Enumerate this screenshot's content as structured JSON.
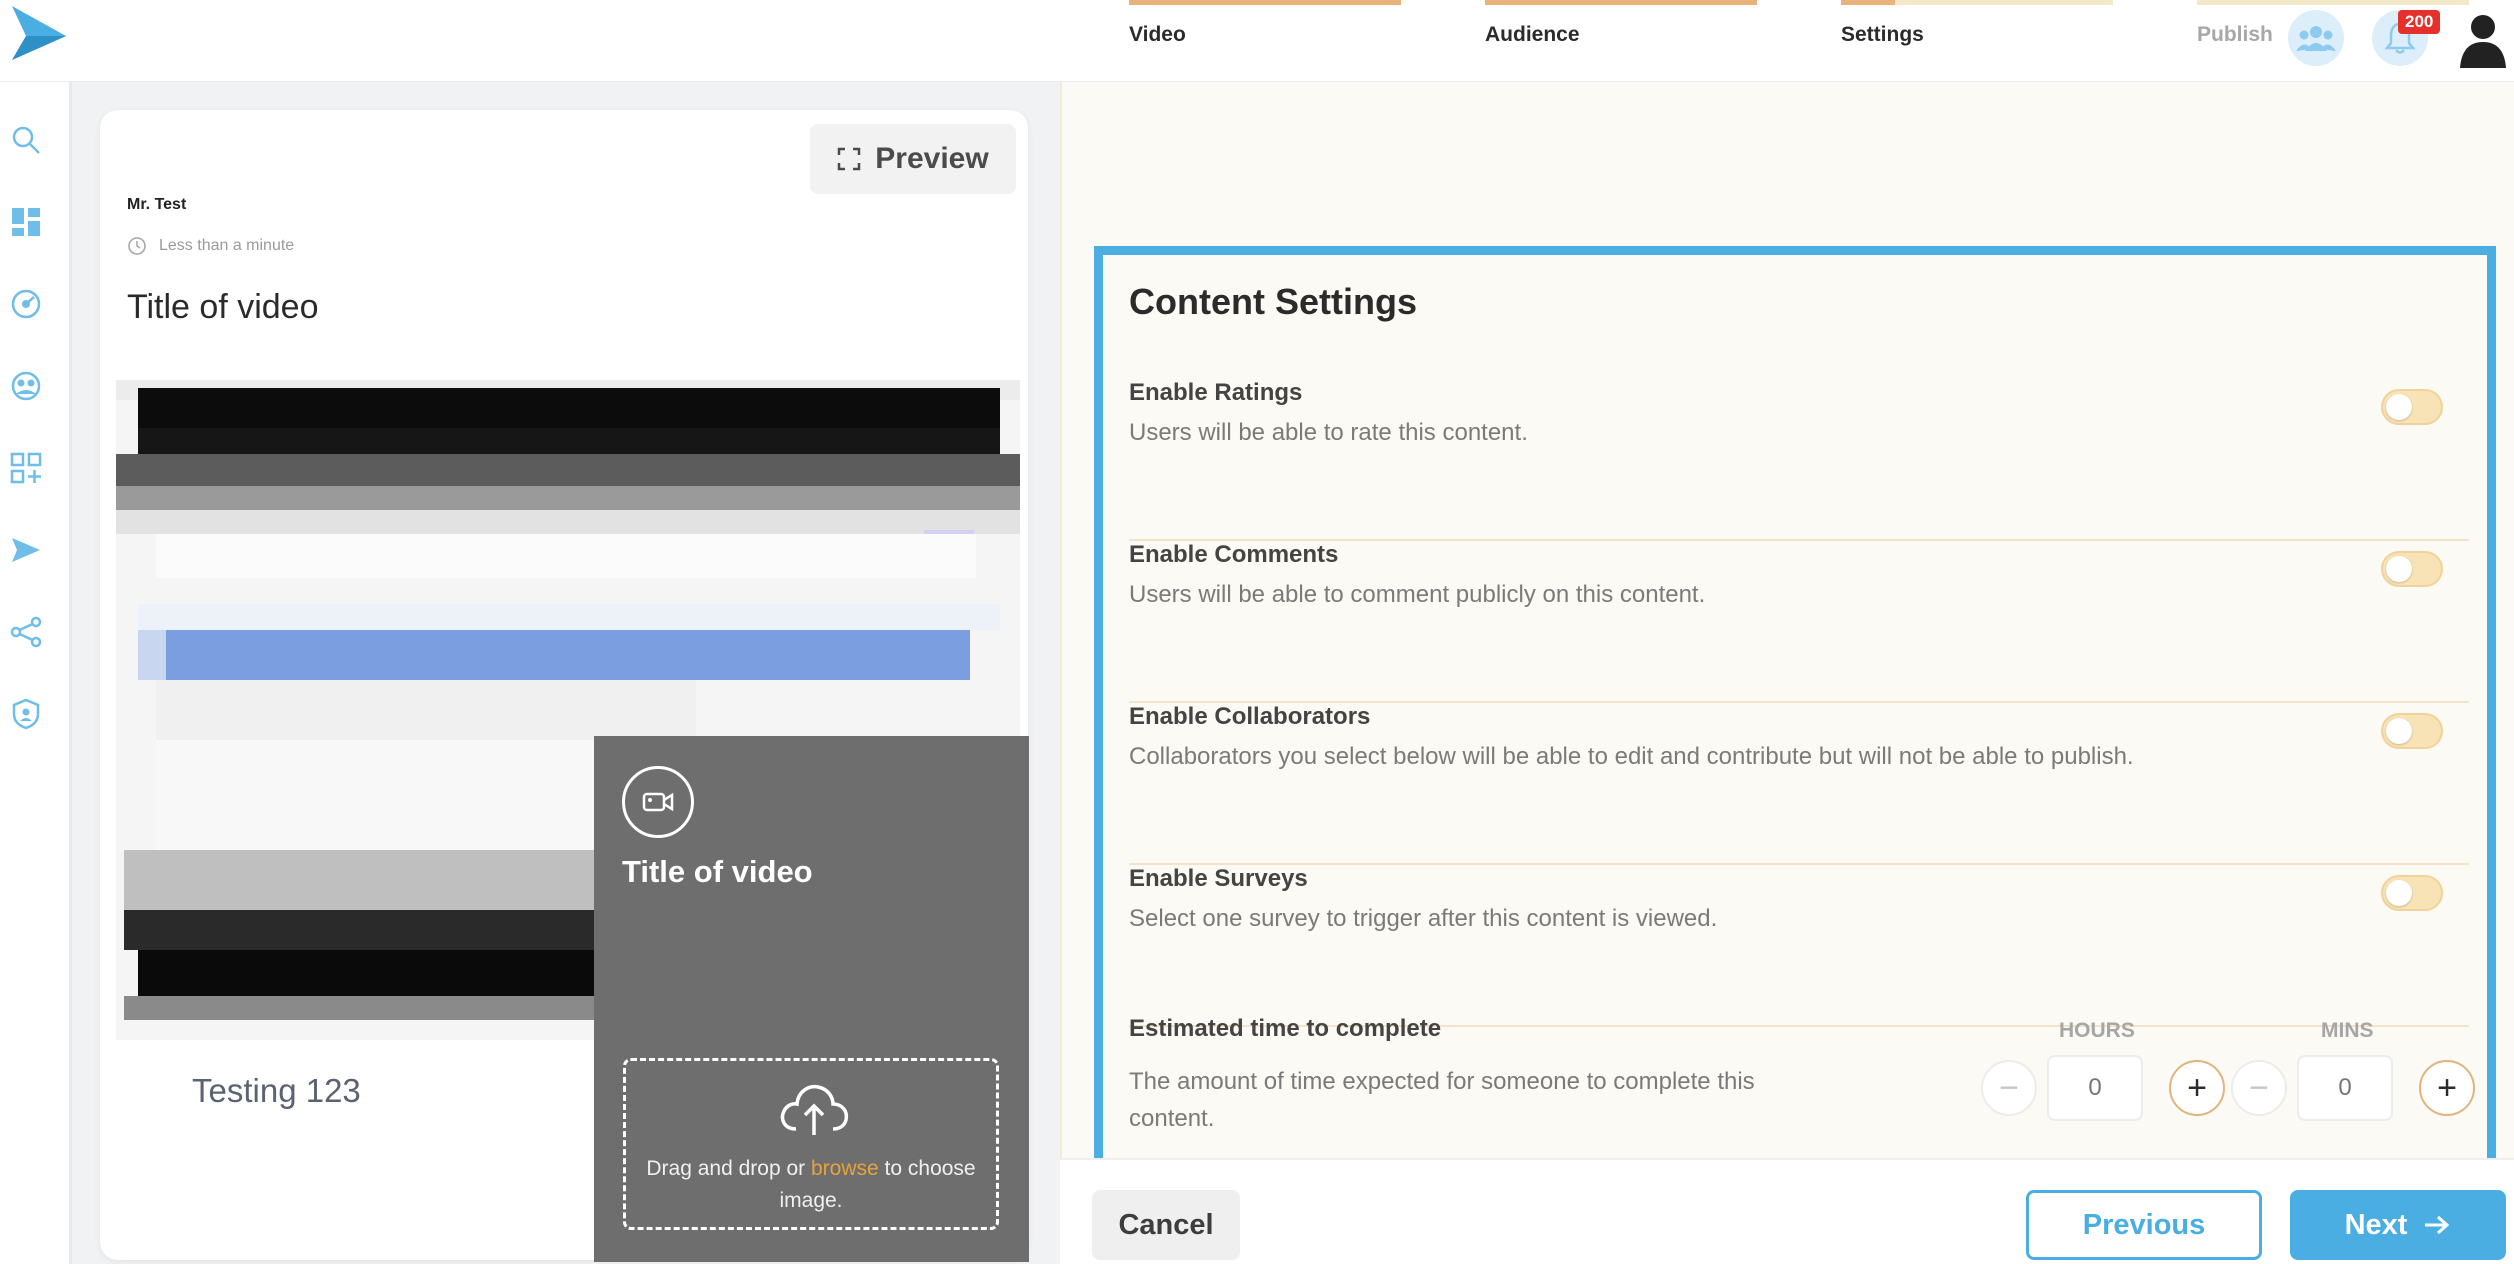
{
  "header": {
    "notification_count": "200",
    "icons": [
      "logo-icon",
      "team-icon",
      "bell-icon",
      "user-icon"
    ]
  },
  "sidebar": {
    "icons": [
      "search-icon",
      "dashboard-icon",
      "analytics-icon",
      "audience-icon",
      "add-widget-icon",
      "send-icon",
      "share-icon",
      "shield-icon"
    ]
  },
  "preview": {
    "button_label": "Preview",
    "author": "Mr. Test",
    "time": "Less than a minute",
    "title": "Title of video",
    "body_text": "Testing 123",
    "overlay_title": "Title of video",
    "drop_text_before": "Drag and drop or ",
    "drop_link": "browse",
    "drop_text_after": " to choose image."
  },
  "steps": [
    {
      "label": "Video",
      "progress": 1.0,
      "state": "done"
    },
    {
      "label": "Audience",
      "progress": 1.0,
      "state": "done"
    },
    {
      "label": "Settings",
      "progress": 0.2,
      "state": "current"
    },
    {
      "label": "Publish",
      "progress": 0.0,
      "state": "todo"
    }
  ],
  "settings": {
    "title": "Content Settings",
    "items": [
      {
        "label": "Enable Ratings",
        "desc": "Users will be able to rate this content.",
        "enabled": false
      },
      {
        "label": "Enable Comments",
        "desc": "Users will be able to comment publicly on this content.",
        "enabled": false
      },
      {
        "label": "Enable Collaborators",
        "desc": "Collaborators you select below will be able to edit and contribute but will not be able to publish.",
        "enabled": false
      },
      {
        "label": "Enable Surveys",
        "desc": "Select one survey to trigger after this content is viewed.",
        "enabled": false
      }
    ],
    "estimate": {
      "label": "Estimated time to complete",
      "desc": "The amount of time expected for someone to complete this content.",
      "hours_label": "HOURS",
      "mins_label": "MINS",
      "hours_value": "0",
      "mins_value": "0"
    }
  },
  "footer": {
    "cancel": "Cancel",
    "previous": "Previous",
    "next": "Next"
  },
  "colors": {
    "accent": "#4aaee3",
    "toggle_off": "#f7e3b5",
    "progress": "#e9b27a",
    "link": "#e5a43a"
  }
}
